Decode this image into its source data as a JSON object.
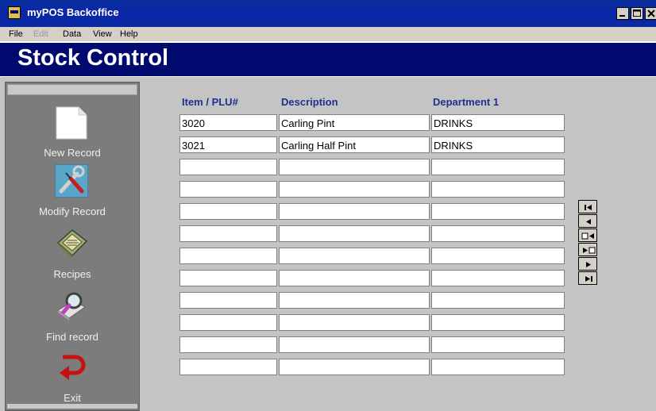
{
  "window": {
    "title": "myPOS Backoffice"
  },
  "menu": [
    {
      "label": "File",
      "enabled": true
    },
    {
      "label": "Edit",
      "enabled": false
    },
    {
      "label": "Data",
      "enabled": true
    },
    {
      "label": "View",
      "enabled": true
    },
    {
      "label": "Help",
      "enabled": true
    }
  ],
  "header": {
    "title": "Stock Control"
  },
  "sidebar": {
    "items": [
      {
        "label": "New Record",
        "icon": "new-page-icon"
      },
      {
        "label": "Modify Record",
        "icon": "wrench-screwdriver-icon"
      },
      {
        "label": "Recipes",
        "icon": "recipe-book-icon"
      },
      {
        "label": "Find record",
        "icon": "magnifier-icon"
      },
      {
        "label": "Exit",
        "icon": "exit-arrow-icon"
      }
    ]
  },
  "grid": {
    "columns": [
      "Item / PLU#",
      "Description",
      "Department 1"
    ],
    "rows": [
      [
        "3020",
        "Carling Pint",
        "DRINKS"
      ],
      [
        "3021",
        "Carling Half Pint",
        "DRINKS"
      ],
      [
        "",
        "",
        ""
      ],
      [
        "",
        "",
        ""
      ],
      [
        "",
        "",
        ""
      ],
      [
        "",
        "",
        ""
      ],
      [
        "",
        "",
        ""
      ],
      [
        "",
        "",
        ""
      ],
      [
        "",
        "",
        ""
      ],
      [
        "",
        "",
        ""
      ],
      [
        "",
        "",
        ""
      ],
      [
        "",
        "",
        ""
      ]
    ]
  },
  "navigator": [
    {
      "name": "first-record",
      "icon": "first-record-icon"
    },
    {
      "name": "previous-record",
      "icon": "previous-record-icon"
    },
    {
      "name": "previous-page",
      "icon": "previous-page-icon"
    },
    {
      "name": "next-page",
      "icon": "next-page-icon"
    },
    {
      "name": "next-record",
      "icon": "next-record-icon"
    },
    {
      "name": "last-record",
      "icon": "last-record-icon"
    }
  ],
  "colors": {
    "titlebar": "#0a25a8",
    "header_band": "#000a6e",
    "sidebar": "#7c7c7c",
    "content": "#c4c4c4",
    "column_header_text": "#203090"
  }
}
